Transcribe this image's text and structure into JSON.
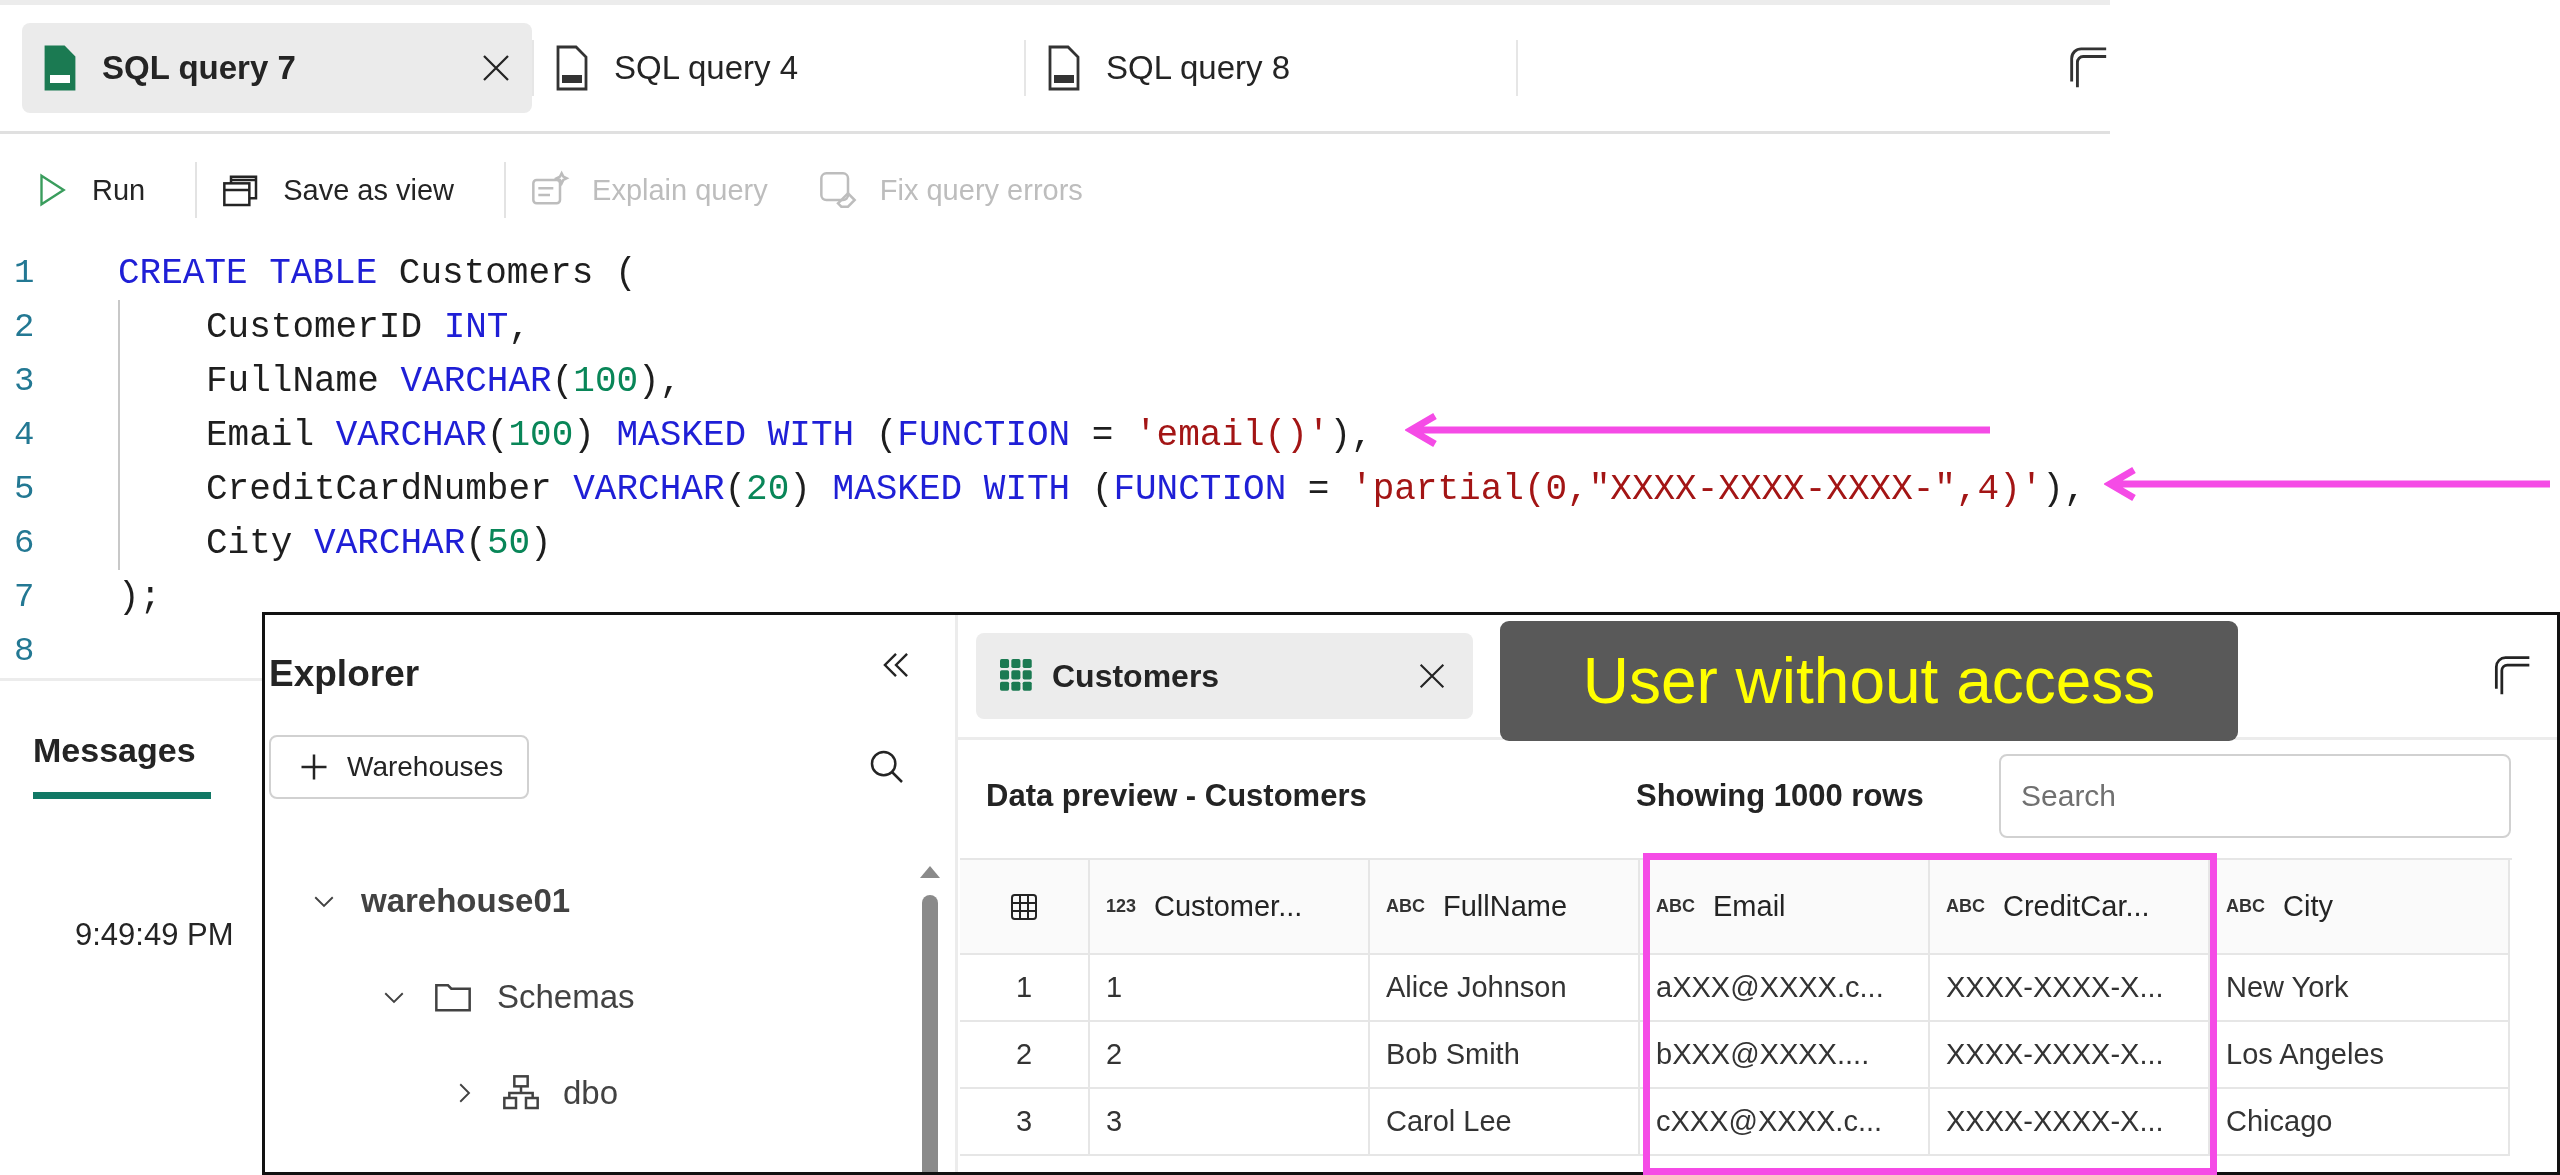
{
  "editor_tabs": [
    {
      "label": "SQL query 7",
      "selected": true
    },
    {
      "label": "SQL query 4",
      "selected": false
    },
    {
      "label": "SQL query 8",
      "selected": false
    }
  ],
  "toolbar": [
    {
      "label": "Run",
      "kind": "run",
      "disabled": false
    },
    {
      "label": "Save as view",
      "kind": "view",
      "disabled": false
    },
    {
      "label": "Explain query",
      "kind": "explain",
      "disabled": true
    },
    {
      "label": "Fix query errors",
      "kind": "fix",
      "disabled": true
    }
  ],
  "code_lines": [
    {
      "number": "1",
      "tokens": [
        {
          "text": "CREATE TABLE",
          "kind": "keyword"
        },
        {
          "text": " Customers (",
          "kind": "plain"
        }
      ],
      "children": [
        {
          "number": "2",
          "tokens": [
            {
              "text": "CustomerID ",
              "kind": "plain"
            },
            {
              "text": "INT",
              "kind": "keyword"
            },
            {
              "text": ",",
              "kind": "plain"
            }
          ]
        },
        {
          "number": "3",
          "tokens": [
            {
              "text": "FullName ",
              "kind": "plain"
            },
            {
              "text": "VARCHAR",
              "kind": "keyword"
            },
            {
              "text": "(",
              "kind": "plain"
            },
            {
              "text": "100",
              "kind": "number"
            },
            {
              "text": "),",
              "kind": "plain"
            }
          ]
        },
        {
          "number": "4",
          "tokens": [
            {
              "text": "Email ",
              "kind": "plain"
            },
            {
              "text": "VARCHAR",
              "kind": "keyword"
            },
            {
              "text": "(",
              "kind": "plain"
            },
            {
              "text": "100",
              "kind": "number"
            },
            {
              "text": ") ",
              "kind": "plain"
            },
            {
              "text": "MASKED WITH",
              "kind": "keyword"
            },
            {
              "text": " (",
              "kind": "plain"
            },
            {
              "text": "FUNCTION",
              "kind": "keyword"
            },
            {
              "text": " = ",
              "kind": "plain"
            },
            {
              "text": "'email()'",
              "kind": "string"
            },
            {
              "text": "),",
              "kind": "plain"
            }
          ]
        },
        {
          "number": "5",
          "tokens": [
            {
              "text": "CreditCardNumber ",
              "kind": "plain"
            },
            {
              "text": "VARCHAR",
              "kind": "keyword"
            },
            {
              "text": "(",
              "kind": "plain"
            },
            {
              "text": "20",
              "kind": "number"
            },
            {
              "text": ") ",
              "kind": "plain"
            },
            {
              "text": "MASKED WITH",
              "kind": "keyword"
            },
            {
              "text": " (",
              "kind": "plain"
            },
            {
              "text": "FUNCTION",
              "kind": "keyword"
            },
            {
              "text": " = ",
              "kind": "plain"
            },
            {
              "text": "'partial(0,\"XXXX-XXXX-XXXX-\",4)'",
              "kind": "string"
            },
            {
              "text": "),",
              "kind": "plain"
            }
          ]
        },
        {
          "number": "6",
          "tokens": [
            {
              "text": "City ",
              "kind": "plain"
            },
            {
              "text": "VARCHAR",
              "kind": "keyword"
            },
            {
              "text": "(",
              "kind": "plain"
            },
            {
              "text": "50",
              "kind": "number"
            },
            {
              "text": ")",
              "kind": "plain"
            }
          ]
        }
      ]
    },
    {
      "number": "7",
      "tokens": [
        {
          "text": ");",
          "kind": "plain"
        }
      ]
    },
    {
      "number": "8"
    }
  ],
  "results_tabs": [
    {
      "label": "Messages",
      "selected": true
    }
  ],
  "messages": [
    {
      "time": "9:49:49 PM"
    }
  ],
  "explorer": {
    "title": "Explorer",
    "add_button": "Warehouses",
    "tree": [
      {
        "label": "warehouse01",
        "expanded": true,
        "children": [
          {
            "label": "Schemas",
            "kind": "folder",
            "expanded": true,
            "children": [
              {
                "label": "dbo",
                "kind": "schema",
                "expanded": false
              }
            ]
          }
        ]
      }
    ]
  },
  "preview": {
    "tab": {
      "label": "Customers",
      "selected": true
    },
    "title": "Data preview - Customers",
    "row_count": "Showing 1000 rows",
    "search": {
      "placeholder": "Search"
    },
    "columns": [
      {
        "type": "123",
        "name": "Customer..."
      },
      {
        "type": "ABC",
        "name": "FullName"
      },
      {
        "type": "ABC",
        "name": "Email"
      },
      {
        "type": "ABC",
        "name": "CreditCar..."
      },
      {
        "type": "ABC",
        "name": "City"
      }
    ],
    "rows": [
      {
        "index": "1",
        "cells": [
          "1",
          "Alice Johnson",
          "aXXX@XXXX.c...",
          "XXXX-XXXX-X...",
          "New York"
        ]
      },
      {
        "index": "2",
        "cells": [
          "2",
          "Bob Smith",
          "bXXX@XXXX....",
          "XXXX-XXXX-X...",
          "Los Angeles"
        ]
      },
      {
        "index": "3",
        "cells": [
          "3",
          "Carol Lee",
          "cXXX@XXXX.c...",
          "XXXX-XXXX-X...",
          "Chicago"
        ]
      }
    ]
  },
  "annotation": {
    "label": "User without access"
  }
}
